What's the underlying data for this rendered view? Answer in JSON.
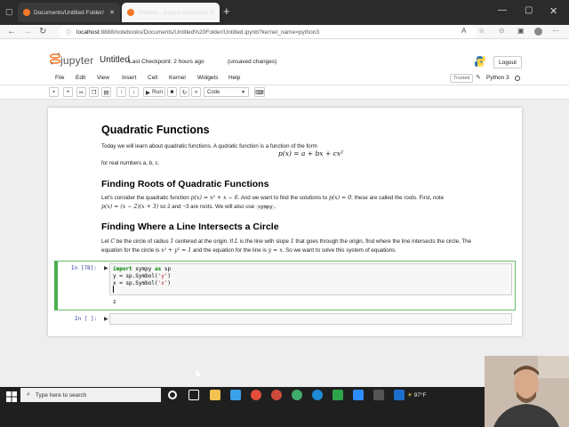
{
  "browser": {
    "tabs": [
      {
        "label": "Documents/Untitled Folder/"
      },
      {
        "label": "Untitled - Jupyter Notebook"
      }
    ],
    "url": {
      "host": "localhost",
      "path": ":8888/notebooks/Documents/Untitled%20Folder/Untitled.ipynb?kernel_name=python3"
    }
  },
  "jupyter": {
    "brand": "jupyter",
    "notebook_name": "Untitled",
    "checkpoint": "Last Checkpoint: 2 hours ago",
    "unsaved": "(unsaved changes)",
    "logout_label": "Logout",
    "menu": [
      "File",
      "Edit",
      "View",
      "Insert",
      "Cell",
      "Kernel",
      "Widgets",
      "Help"
    ],
    "trusted": "Trusted",
    "kernel": "Python 3",
    "run_label": "Run",
    "cell_type": "Code"
  },
  "notebook": {
    "h1": "Quadratic Functions",
    "p1": "Today we will learn about quadratic functions. A qudratic function is a function of the form",
    "eq1": "p(x) = a + bx + cx²",
    "p2": "for real numbers a, b, c.",
    "h2a": "Finding Roots of Quadratic Functions",
    "p3a": "Let's consider the quadratic function",
    "p3_eq": "p(x) = x² + x − 6",
    "p3b": ". And we want to find the solutions to",
    "p3_eq2": "p(x) = 0",
    "p3c": "; these are called the roots. First, note",
    "p4_eq": "p(x) = (x − 2)(x + 3)",
    "p4b": "so 2 and −3 are roots. We will also use",
    "p4_code": "sympy",
    "p4c": ".",
    "h2b": "Finding Where a Line Intersects a Circle",
    "p5a": "Let",
    "p5_C": "C",
    "p5b": "be the circle of radius",
    "p5_1": "1",
    "p5c": "centered at the origin. If",
    "p5_L": "L",
    "p5d": "is the line with slope",
    "p5_s": "1",
    "p5e": "that goes through the origin, find where the line intersects the circle. The",
    "p6a": "equation for the circle is",
    "p6_eq": "x² + y² = 1",
    "p6b": "and the equation for the line is",
    "p6_eq2": "y = x",
    "p6c": ". So we want to solve this system of equations.",
    "prompt_in78": "In [78]:",
    "code": {
      "l1_kw1": "import",
      "l1_mid": " sympy ",
      "l1_kw2": "as",
      "l1_end": " sp",
      "l2_a": "y = sp.Symbol(",
      "l2_s": "'y'",
      "l2_b": ")",
      "l3_a": "x = sp.Symbol(",
      "l3_s": "'x'",
      "l3_b": ")"
    },
    "output": "z",
    "prompt_empty": "In [ ]:"
  },
  "taskbar": {
    "search_placeholder": "Type here to search",
    "weather": "97°F"
  }
}
